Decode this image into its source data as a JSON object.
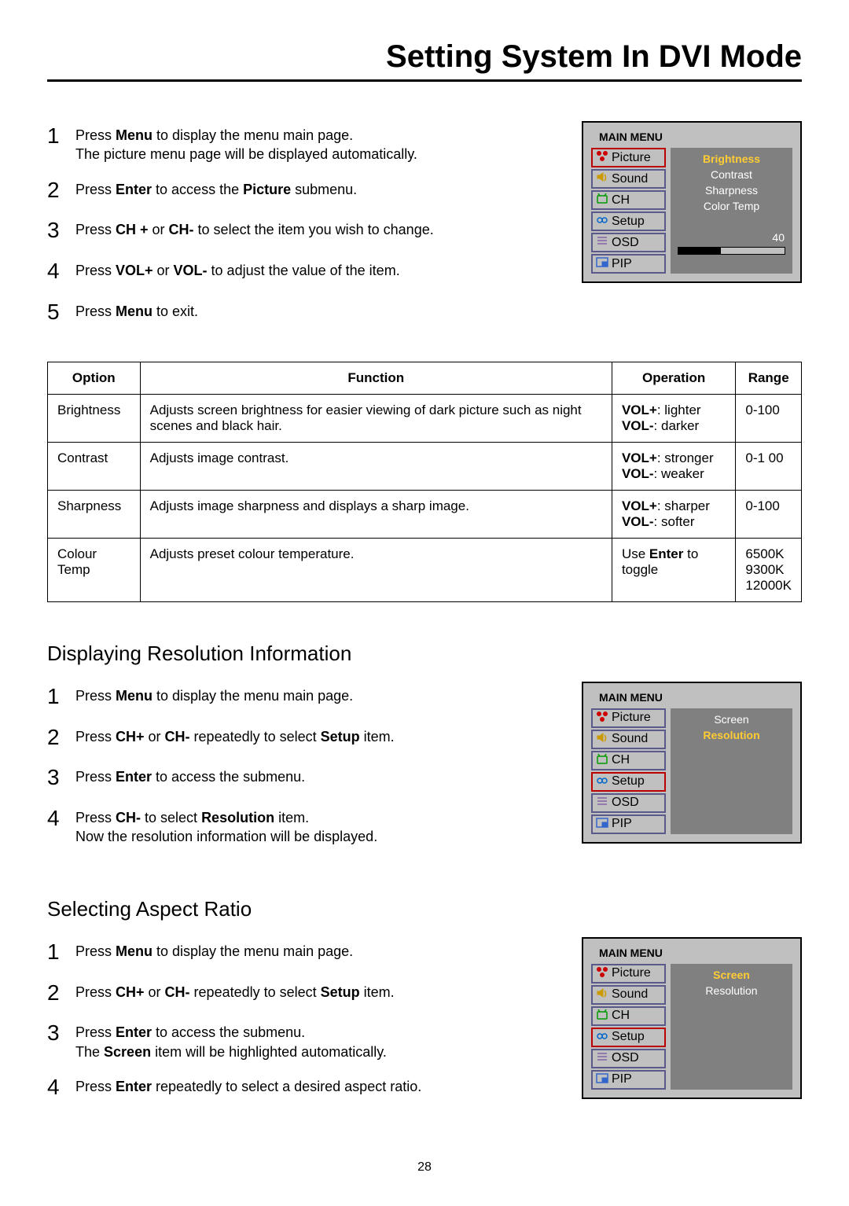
{
  "page_title": "Setting System In DVI Mode",
  "page_number": "28",
  "sections": [
    {
      "steps": [
        [
          {
            "t": "Press "
          },
          {
            "t": "Menu",
            "b": true
          },
          {
            "t": " to display the menu main page."
          },
          {
            "br": true
          },
          {
            "t": "The picture menu page will be displayed automatically."
          }
        ],
        [
          {
            "t": "Press "
          },
          {
            "t": "Enter",
            "b": true
          },
          {
            "t": " to access the "
          },
          {
            "t": "Picture",
            "b": true
          },
          {
            "t": " submenu."
          }
        ],
        [
          {
            "t": "Press "
          },
          {
            "t": "CH +",
            "b": true
          },
          {
            "t": " or "
          },
          {
            "t": "CH-",
            "b": true
          },
          {
            "t": " to select the item you wish to change."
          }
        ],
        [
          {
            "t": "Press "
          },
          {
            "t": "VOL+",
            "b": true
          },
          {
            "t": " or "
          },
          {
            "t": "VOL-",
            "b": true
          },
          {
            "t": " to adjust the value of the item."
          }
        ],
        [
          {
            "t": "Press "
          },
          {
            "t": "Menu",
            "b": true
          },
          {
            "t": " to exit."
          }
        ]
      ],
      "osd": {
        "title": "MAIN MENU",
        "left": [
          "Picture",
          "Sound",
          "CH",
          "Setup",
          "OSD",
          "PIP"
        ],
        "selected": 0,
        "right": {
          "items": [
            "Brightness",
            "Contrast",
            "Sharpness",
            "Color Temp"
          ],
          "highlight": 0,
          "slider_value": "40",
          "show_slider": true
        }
      }
    },
    {
      "heading": "Displaying Resolution Information",
      "steps": [
        [
          {
            "t": "Press "
          },
          {
            "t": "Menu",
            "b": true
          },
          {
            "t": " to display the menu main page."
          }
        ],
        [
          {
            "t": "Press "
          },
          {
            "t": "CH+",
            "b": true
          },
          {
            "t": " or "
          },
          {
            "t": "CH-",
            "b": true
          },
          {
            "t": " repeatedly to select "
          },
          {
            "t": "Setup",
            "b": true
          },
          {
            "t": " item."
          }
        ],
        [
          {
            "t": "Press "
          },
          {
            "t": "Enter",
            "b": true
          },
          {
            "t": " to access the submenu."
          }
        ],
        [
          {
            "t": "Press "
          },
          {
            "t": "CH-",
            "b": true
          },
          {
            "t": " to select "
          },
          {
            "t": "Resolution",
            "b": true
          },
          {
            "t": " item."
          },
          {
            "br": true
          },
          {
            "t": "Now the resolution information will be displayed."
          }
        ]
      ],
      "osd": {
        "title": "MAIN MENU",
        "left": [
          "Picture",
          "Sound",
          "CH",
          "Setup",
          "OSD",
          "PIP"
        ],
        "selected": 3,
        "right": {
          "items": [
            "Screen",
            "Resolution"
          ],
          "highlight": 1,
          "show_slider": false
        }
      }
    },
    {
      "heading": "Selecting Aspect Ratio",
      "steps": [
        [
          {
            "t": "Press "
          },
          {
            "t": "Menu",
            "b": true
          },
          {
            "t": " to display the menu main page."
          }
        ],
        [
          {
            "t": "Press "
          },
          {
            "t": "CH+",
            "b": true
          },
          {
            "t": " or "
          },
          {
            "t": "CH-",
            "b": true
          },
          {
            "t": " repeatedly to select "
          },
          {
            "t": "Setup",
            "b": true
          },
          {
            "t": " item."
          }
        ],
        [
          {
            "t": "Press "
          },
          {
            "t": "Enter",
            "b": true
          },
          {
            "t": " to access the submenu."
          },
          {
            "br": true
          },
          {
            "t": "The "
          },
          {
            "t": "Screen",
            "b": true
          },
          {
            "t": " item will be highlighted automatically."
          }
        ],
        [
          {
            "t": "Press "
          },
          {
            "t": "Enter",
            "b": true
          },
          {
            "t": " repeatedly to select a desired aspect ratio."
          }
        ]
      ],
      "osd": {
        "title": "MAIN MENU",
        "left": [
          "Picture",
          "Sound",
          "CH",
          "Setup",
          "OSD",
          "PIP"
        ],
        "selected": 3,
        "right": {
          "items": [
            "Screen",
            "Resolution"
          ],
          "highlight": 0,
          "show_slider": false
        }
      }
    }
  ],
  "table": {
    "headers": [
      "Option",
      "Function",
      "Operation",
      "Range"
    ],
    "rows": [
      {
        "option": "Brightness",
        "function": "Adjusts screen brightness for easier viewing of dark picture such as night scenes and black hair.",
        "operation": [
          {
            "b": "VOL+",
            "t": ": lighter"
          },
          {
            "b": "VOL-",
            "t": ": darker"
          }
        ],
        "range": "0-100"
      },
      {
        "option": "Contrast",
        "function": "Adjusts image contrast.",
        "operation": [
          {
            "b": "VOL+",
            "t": ": stronger"
          },
          {
            "b": "VOL-",
            "t": ": weaker"
          }
        ],
        "range": "0-1 00"
      },
      {
        "option": "Sharpness",
        "function": "Adjusts image sharpness and displays a sharp image.",
        "operation": [
          {
            "b": "VOL+",
            "t": ": sharper"
          },
          {
            "b": "VOL-",
            "t": ": softer"
          }
        ],
        "range": "0-100"
      },
      {
        "option": "Colour Temp",
        "function": "Adjusts preset colour temperature.",
        "operation": [
          {
            "t": "Use "
          },
          {
            "b": "Enter"
          },
          {
            "t": " to toggle"
          }
        ],
        "operation_single": true,
        "range": "6500K\n9300K\n12000K"
      }
    ]
  },
  "icons": [
    "picture",
    "sound",
    "ch",
    "setup",
    "osd",
    "pip"
  ]
}
